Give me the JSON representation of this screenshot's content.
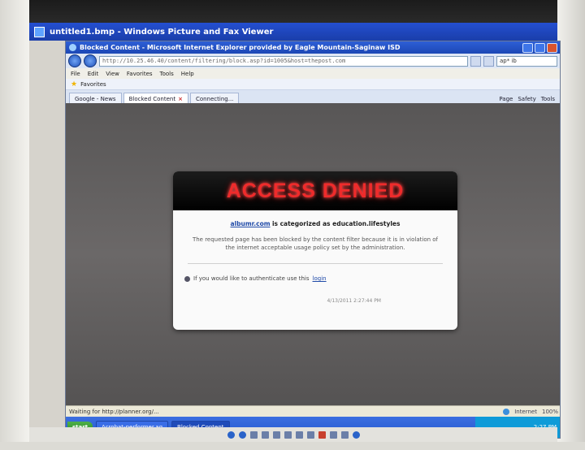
{
  "viewer": {
    "title": "untitled1.bmp - Windows Picture and Fax Viewer"
  },
  "browser": {
    "title": "Blocked Content - Microsoft Internet Explorer provided by Eagle Mountain-Saginaw ISD",
    "address": "http://10.25.46.40/content/filtering/block.asp?id=1005&host=thepost.com",
    "search_value": "ap* ib",
    "menu": [
      "File",
      "Edit",
      "View",
      "Favorites",
      "Tools",
      "Help"
    ],
    "favorites_label": "Favorites",
    "tabs": [
      {
        "label": "Google - News",
        "active": false
      },
      {
        "label": "Blocked Content",
        "active": true
      },
      {
        "label": "Connecting...",
        "active": false
      }
    ],
    "command_bar": [
      "Page",
      "Safety",
      "Tools"
    ],
    "status_text": "Waiting for http://planner.org/...",
    "status_zone": "Internet",
    "zoom": "100%"
  },
  "card": {
    "title": "ACCESS DENIED",
    "site": "albumr.com",
    "category_text": "is categorized as education.lifestyles",
    "message": "The requested page has been blocked by the content filter because it is in violation of the internet acceptable usage policy set by the administration.",
    "auth_text": "If you would like to authenticate use this",
    "auth_link": "login",
    "timestamp": "4/13/2011 2:27:44 PM"
  },
  "taskbar": {
    "start": "start",
    "items": [
      {
        "label": "Acrobat-performer.aq",
        "active": false
      },
      {
        "label": "Blocked Content",
        "active": true
      }
    ],
    "clock": "2:27 PM"
  }
}
